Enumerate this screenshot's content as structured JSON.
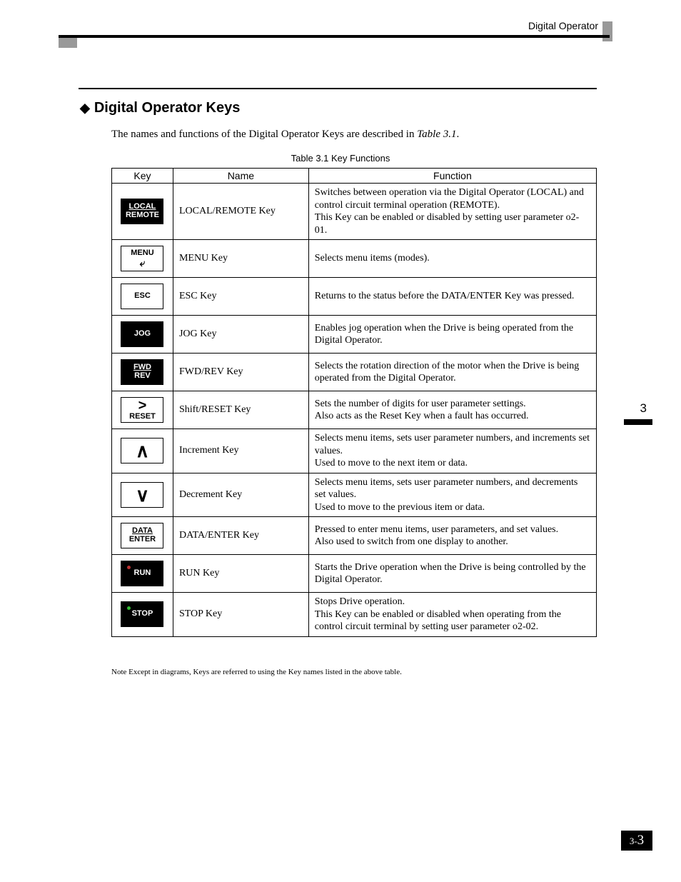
{
  "header": {
    "running_title": "Digital Operator"
  },
  "section": {
    "heading": "Digital Operator Keys",
    "intro_pre": "The names and functions of the Digital Operator Keys are described in ",
    "intro_ref": "Table 3.1",
    "intro_post": "."
  },
  "table": {
    "caption": "Table 3.1  Key Functions",
    "cols": {
      "key": "Key",
      "name": "Name",
      "func": "Function"
    },
    "rows": [
      {
        "key_style": "black",
        "key_l1": "LOCAL",
        "key_l2": "REMOTE",
        "key_l1_underline": true,
        "name": "LOCAL/REMOTE Key",
        "func": "Switches between operation via the Digital Operator (LOCAL) and control circuit terminal operation (REMOTE).\nThis Key can be enabled or disabled by setting user parameter o2-01."
      },
      {
        "key_style": "white",
        "key_l1": "MENU",
        "key_arrow_enter": true,
        "name": "MENU Key",
        "func": "Selects menu items (modes)."
      },
      {
        "key_style": "white",
        "key_l1": "ESC",
        "name": "ESC Key",
        "func": "Returns to the status before the DATA/ENTER Key was pressed."
      },
      {
        "key_style": "black",
        "key_l1": "JOG",
        "name": "JOG Key",
        "func": "Enables jog operation when the Drive is being operated from the Digital Operator."
      },
      {
        "key_style": "black",
        "key_l1": "FWD",
        "key_l2": "REV",
        "key_l1_underline": true,
        "name": "FWD/REV Key",
        "func": "Selects the rotation direction of the motor when the Drive is being operated from the Digital Operator."
      },
      {
        "key_style": "white",
        "key_arrow": ">",
        "key_l2": "RESET",
        "name": "Shift/RESET Key",
        "func": "Sets the number of digits for user parameter settings.\nAlso acts as the Reset Key when a fault has occurred."
      },
      {
        "key_style": "white",
        "key_arrow_big": "∧",
        "name": "Increment Key",
        "func": "Selects menu items, sets user parameter numbers, and increments set values.\nUsed to move to the next item or data."
      },
      {
        "key_style": "white",
        "key_arrow_big": "∨",
        "name": "Decrement Key",
        "func": "Selects menu items, sets user parameter numbers, and decrements set values.\nUsed to move to the previous item or data."
      },
      {
        "key_style": "white",
        "key_l1": "DATA",
        "key_l2": "ENTER",
        "key_l1_underline": true,
        "name": "DATA/ENTER Key",
        "func": "Pressed to enter menu items, user parameters, and set values.\nAlso used to switch from one display to another."
      },
      {
        "key_style": "black run",
        "key_l1": "RUN",
        "name": "RUN Key",
        "func": "Starts the Drive operation when the Drive is being controlled by the Digital Operator."
      },
      {
        "key_style": "black stop",
        "key_l1": "STOP",
        "name": "STOP Key",
        "func": "Stops Drive operation.\nThis Key can be enabled or disabled when operating from the control circuit terminal by setting user parameter o2-02."
      }
    ],
    "note": "Note  Except in diagrams, Keys are referred to using the Key names listed in the above table."
  },
  "side": {
    "chapter": "3"
  },
  "page": {
    "prefix": "3-",
    "number": "3"
  }
}
